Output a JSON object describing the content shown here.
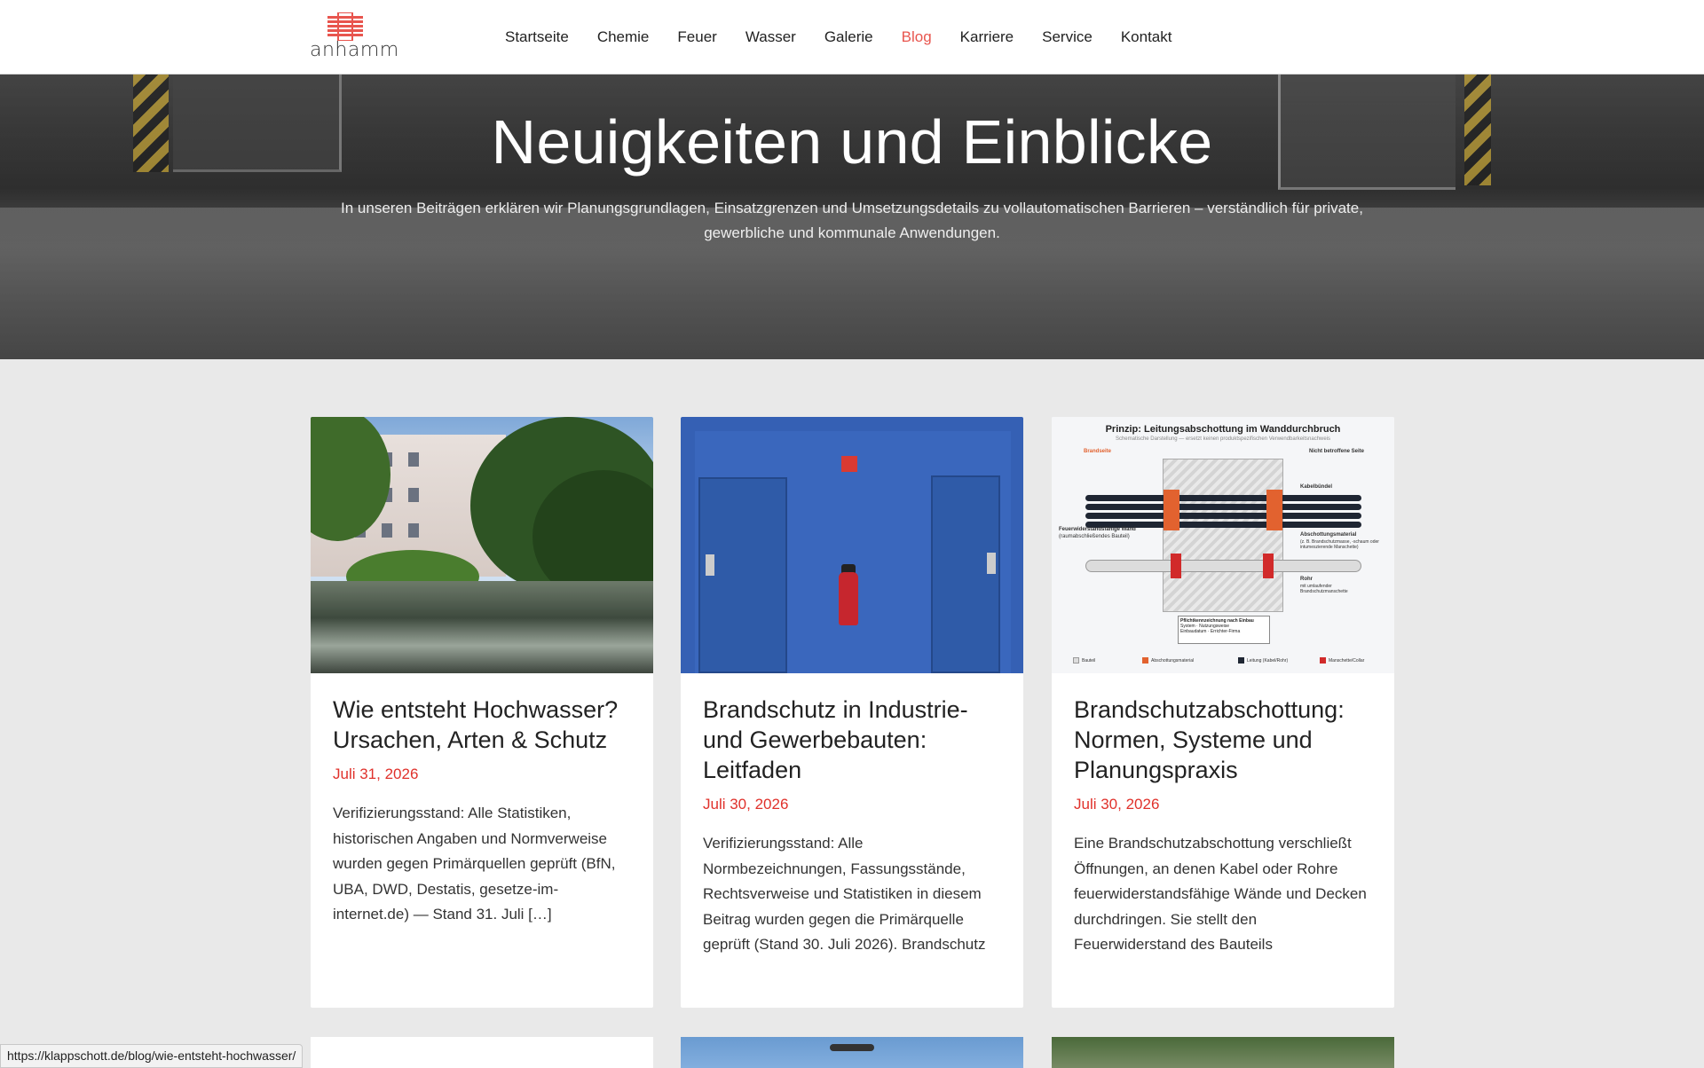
{
  "header": {
    "logo_text": "anhamm",
    "nav": [
      {
        "label": "Startseite"
      },
      {
        "label": "Chemie"
      },
      {
        "label": "Feuer"
      },
      {
        "label": "Wasser"
      },
      {
        "label": "Galerie"
      },
      {
        "label": "Blog",
        "active": true
      },
      {
        "label": "Karriere"
      },
      {
        "label": "Service"
      },
      {
        "label": "Kontakt"
      }
    ]
  },
  "hero": {
    "title": "Neuigkeiten und Einblicke",
    "subtitle": "In unseren Beiträgen erklären wir Planungsgrundlagen, Einsatzgrenzen und Umsetzungsdetails zu vollautomatischen Barrieren – verständlich für private, gewerbliche und kommunale Anwendungen."
  },
  "posts": [
    {
      "title": "Wie entsteht Hochwasser? Ursachen, Arten & Schutz",
      "date": "Juli 31, 2026",
      "excerpt": "Verifizierungsstand: Alle Statistiken, historischen Angaben und Normverweise wurden gegen Primärquellen geprüft (BfN, UBA, DWD, Destatis, gesetze-im-internet.de) — Stand 31. Juli […]",
      "image": "flood-photo"
    },
    {
      "title": "Brandschutz in Industrie- und Gewerbebauten: Leitfaden",
      "date": "Juli 30, 2026",
      "excerpt": "Verifizierungsstand: Alle Normbezeichnungen, Fassungsstände, Rechtsverweise und Statistiken in diesem Beitrag wurden gegen die Primärquelle geprüft (Stand 30. Juli 2026). Brandschutz",
      "image": "blue-wall-extinguisher-photo"
    },
    {
      "title": "Brandschutzabschottung: Normen, Systeme und Planungspraxis",
      "date": "Juli 30, 2026",
      "excerpt": "Eine Brandschutzabschottung verschließt Öffnungen, an denen Kabel oder Rohre feuerwiderstandsfähige Wände und Decken durchdringen. Sie stellt den Feuerwiderstand des Bauteils",
      "image": "sealing-diagram",
      "diagram": {
        "title": "Prinzip: Leitungsabschottung im Wanddurchbruch",
        "subtitle": "Schematische Darstellung — ersetzt keinen produktspezifischen Verwendbarkeitsnachweis",
        "left_label": "Brandseite",
        "right_label": "Nicht betroffene Seite",
        "labels": {
          "kabel": "Kabelbündel",
          "wand": "Feuerwiderstandsfähige Wand",
          "wand_sub": "(raumabschließendes Bauteil)",
          "material": "Abschottungsmaterial",
          "material_sub": "(z. B. Brandschutzmasse, -schaum oder intumeszierende Manschette)",
          "rohr": "Rohr",
          "rohr_sub": "mit umlaufender Brandschutzmanschette",
          "pflicht": "Pflichtkennzeichnung nach Einbau"
        },
        "note_lines": [
          "System · Nutzungsweise",
          "Einbaudatum · Errichter-Firma"
        ],
        "legend": [
          "Bauteil",
          "Abschottungsmaterial",
          "Leitung (Kabel/Rohr)",
          "Manschette/Collar"
        ]
      }
    }
  ],
  "status_url": "https://klappschott.de/blog/wie-entsteht-hochwasser/",
  "colors": {
    "accent": "#e8554e",
    "date": "#e0312b",
    "page_bg": "#e9e9e9"
  }
}
